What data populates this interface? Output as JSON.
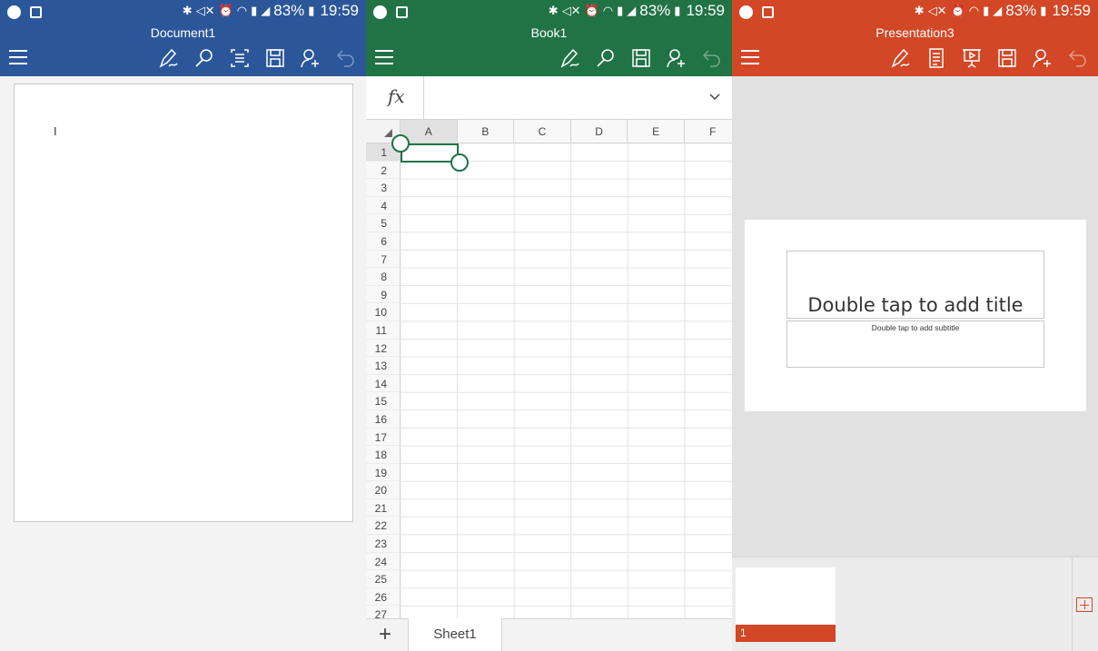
{
  "status_bar": {
    "battery": "83%",
    "time": "19:59"
  },
  "word": {
    "title": "Document1",
    "cursor": "I"
  },
  "excel": {
    "title": "Book1",
    "formula_label": "fx",
    "columns": [
      "A",
      "B",
      "C",
      "D",
      "E",
      "F"
    ],
    "rows": [
      "1",
      "2",
      "3",
      "4",
      "5",
      "6",
      "7",
      "8",
      "9",
      "10",
      "11",
      "12",
      "13",
      "14",
      "15",
      "16",
      "17",
      "18",
      "19",
      "20",
      "21",
      "22",
      "23",
      "24",
      "25",
      "26",
      "27"
    ],
    "add_sheet": "+",
    "sheet_tab": "Sheet1"
  },
  "powerpoint": {
    "title": "Presentation3",
    "title_placeholder": "Double tap to add title",
    "subtitle_placeholder": "Double tap to add subtitle",
    "slide_number": "1"
  },
  "colors": {
    "word": "#2b579a",
    "excel": "#217346",
    "powerpoint": "#d24726"
  }
}
